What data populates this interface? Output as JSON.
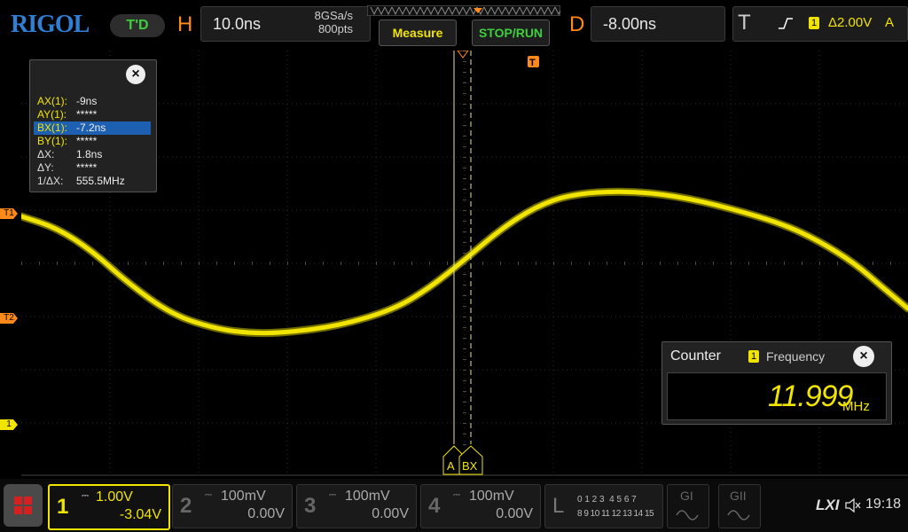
{
  "brand": {
    "logo": "RIGOL",
    "mode_badge": "T'D"
  },
  "horizontal": {
    "letter": "H",
    "timebase": "10.0ns",
    "sample_rate": "8GSa/s",
    "memory_depth": "800pts"
  },
  "buttons": {
    "measure": "Measure",
    "stop_run": "STOP/RUN"
  },
  "delay": {
    "letter": "D",
    "value": "-8.00ns"
  },
  "trigger": {
    "letter": "T",
    "source": "1",
    "level": "Δ2.00V",
    "mode": "A"
  },
  "cursor_panel": {
    "rows": [
      {
        "key": "AX(1):",
        "value": "-9ns"
      },
      {
        "key": "AY(1):",
        "value": "*****"
      },
      {
        "key": "BX(1):",
        "value": "-7.2ns"
      },
      {
        "key": "BY(1):",
        "value": "*****"
      },
      {
        "key": "ΔX:",
        "value": "1.8ns"
      },
      {
        "key": "ΔY:",
        "value": "*****"
      },
      {
        "key": "1/ΔX:",
        "value": "555.5MHz"
      }
    ],
    "close": "×"
  },
  "screen_markers": {
    "top_trigger": "T",
    "t1": "T1",
    "t2": "T2",
    "ch1": "1",
    "cursor_a": "A",
    "cursor_b": "BX"
  },
  "counter": {
    "title": "Counter",
    "channel": "1",
    "label": "Frequency",
    "value": "11.999",
    "unit": "MHz",
    "close": "×"
  },
  "channels": [
    {
      "num": "1",
      "scale": "1.00V",
      "offset": "-3.04V"
    },
    {
      "num": "2",
      "scale": "100mV",
      "offset": "0.00V"
    },
    {
      "num": "3",
      "scale": "100mV",
      "offset": "0.00V"
    },
    {
      "num": "4",
      "scale": "100mV",
      "offset": "0.00V"
    }
  ],
  "logic": {
    "letter": "L",
    "row1": "0 1 2 3  4 5 6 7",
    "row2": "8 9 10 11 12 13 14 15"
  },
  "generators": {
    "g1": "GI",
    "g2": "GII"
  },
  "status": {
    "lxi": "LXI",
    "time": "19:18"
  },
  "colors": {
    "ch1": "#f1e400",
    "ch2": "#00c8e6",
    "ch3": "#e040c0",
    "ch4": "#2f7fd4",
    "accent": "#ff8a1a",
    "green": "#3ecf3e"
  }
}
